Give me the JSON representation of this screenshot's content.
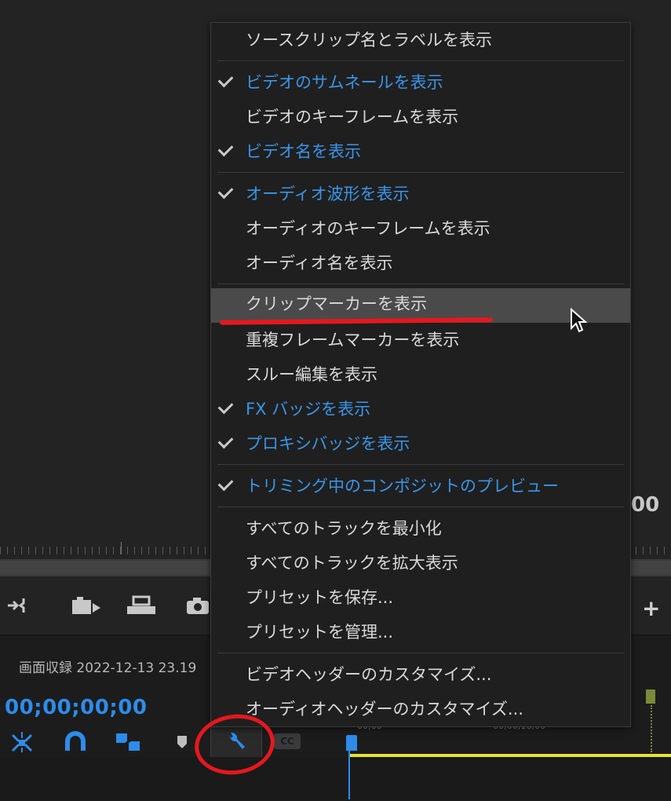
{
  "menu": {
    "items": [
      {
        "label": "ソースクリップ名とラベルを表示",
        "checked": false
      },
      {
        "label": "ビデオのサムネールを表示",
        "checked": true
      },
      {
        "label": "ビデオのキーフレームを表示",
        "checked": false
      },
      {
        "label": "ビデオ名を表示",
        "checked": true
      },
      {
        "label": "オーディオ波形を表示",
        "checked": true
      },
      {
        "label": "オーディオのキーフレームを表示",
        "checked": false
      },
      {
        "label": "オーディオ名を表示",
        "checked": false
      },
      {
        "label": "クリップマーカーを表示",
        "checked": false,
        "hovered": true
      },
      {
        "label": "重複フレームマーカーを表示",
        "checked": false
      },
      {
        "label": "スルー編集を表示",
        "checked": false
      },
      {
        "label": "FX バッジを表示",
        "checked": true
      },
      {
        "label": "プロキシバッジを表示",
        "checked": true
      },
      {
        "label": "トリミング中のコンポジットのプレビュー",
        "checked": true
      },
      {
        "label": "すべてのトラックを最小化",
        "checked": false
      },
      {
        "label": "すべてのトラックを拡大表示",
        "checked": false
      },
      {
        "label": "プリセットを保存...",
        "checked": false
      },
      {
        "label": "プリセットを管理...",
        "checked": false
      },
      {
        "label": "ビデオヘッダーのカスタマイズ...",
        "checked": false
      },
      {
        "label": "オーディオヘッダーのカスタマイズ...",
        "checked": false
      }
    ]
  },
  "timeline": {
    "sequence_title": "画面収録 2022-12-13 23.19",
    "timecode": "00;00;00;00",
    "ruler_time_1": "00;00",
    "ruler_time_2": "00;00;16;00",
    "cc_label": "CC"
  },
  "monitor": {
    "timecode_fragment": "00"
  },
  "colors": {
    "accent_blue": "#2d8ceb",
    "checked_text": "#3a95e8",
    "annotation_red": "#e5181e",
    "clip_yellow": "#e8e235"
  },
  "icons": [
    "checkmark-icon",
    "insert-icon",
    "overwrite-icon",
    "export-frame-icon",
    "camera-icon",
    "plus-icon",
    "snap-icon",
    "magnet-icon",
    "linked-selection-icon",
    "marker-icon",
    "wrench-icon",
    "cc-icon",
    "mouse-cursor-icon"
  ]
}
